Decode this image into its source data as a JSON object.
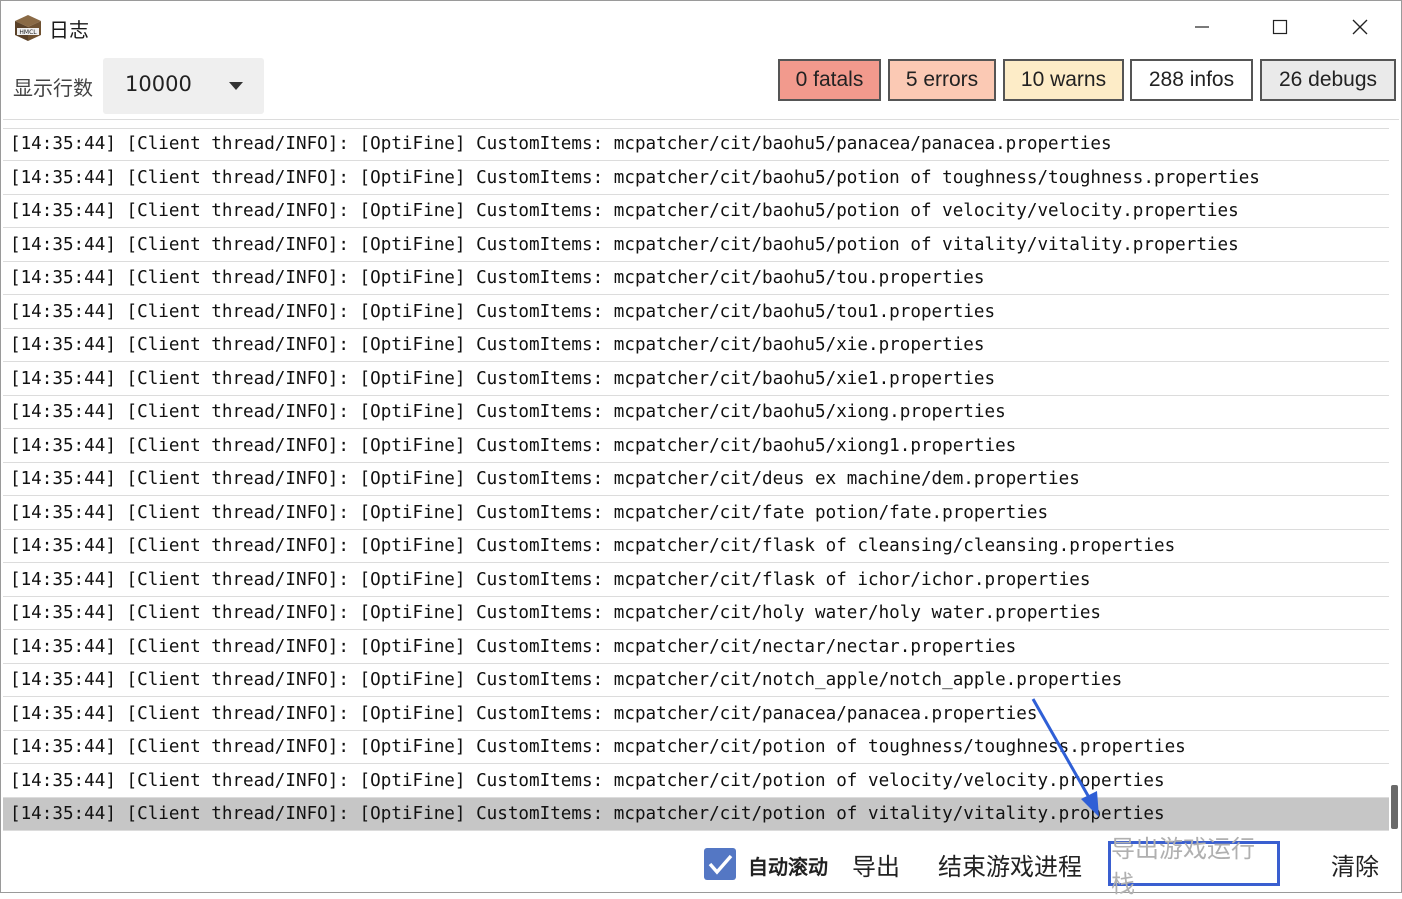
{
  "window": {
    "title": "日志",
    "icon": "hmcl-icon",
    "controls": [
      "minimize-icon",
      "maximize-icon",
      "close-icon"
    ]
  },
  "toolbar": {
    "rows_label": "显示行数",
    "rows_value": "10000",
    "filters": {
      "fatals": "0 fatals",
      "errors": "5 errors",
      "warns": "10 warns",
      "infos": "288 infos",
      "debugs": "26 debugs"
    }
  },
  "log": {
    "lines": [
      "[14:35:44] [Client thread/INFO]: [OptiFine] CustomItems: mcpatcher/cit/baohu5/panacea/panacea.properties",
      "[14:35:44] [Client thread/INFO]: [OptiFine] CustomItems: mcpatcher/cit/baohu5/potion of toughness/toughness.properties",
      "[14:35:44] [Client thread/INFO]: [OptiFine] CustomItems: mcpatcher/cit/baohu5/potion of velocity/velocity.properties",
      "[14:35:44] [Client thread/INFO]: [OptiFine] CustomItems: mcpatcher/cit/baohu5/potion of vitality/vitality.properties",
      "[14:35:44] [Client thread/INFO]: [OptiFine] CustomItems: mcpatcher/cit/baohu5/tou.properties",
      "[14:35:44] [Client thread/INFO]: [OptiFine] CustomItems: mcpatcher/cit/baohu5/tou1.properties",
      "[14:35:44] [Client thread/INFO]: [OptiFine] CustomItems: mcpatcher/cit/baohu5/xie.properties",
      "[14:35:44] [Client thread/INFO]: [OptiFine] CustomItems: mcpatcher/cit/baohu5/xie1.properties",
      "[14:35:44] [Client thread/INFO]: [OptiFine] CustomItems: mcpatcher/cit/baohu5/xiong.properties",
      "[14:35:44] [Client thread/INFO]: [OptiFine] CustomItems: mcpatcher/cit/baohu5/xiong1.properties",
      "[14:35:44] [Client thread/INFO]: [OptiFine] CustomItems: mcpatcher/cit/deus ex machine/dem.properties",
      "[14:35:44] [Client thread/INFO]: [OptiFine] CustomItems: mcpatcher/cit/fate potion/fate.properties",
      "[14:35:44] [Client thread/INFO]: [OptiFine] CustomItems: mcpatcher/cit/flask of cleansing/cleansing.properties",
      "[14:35:44] [Client thread/INFO]: [OptiFine] CustomItems: mcpatcher/cit/flask of ichor/ichor.properties",
      "[14:35:44] [Client thread/INFO]: [OptiFine] CustomItems: mcpatcher/cit/holy water/holy water.properties",
      "[14:35:44] [Client thread/INFO]: [OptiFine] CustomItems: mcpatcher/cit/nectar/nectar.properties",
      "[14:35:44] [Client thread/INFO]: [OptiFine] CustomItems: mcpatcher/cit/notch_apple/notch_apple.properties",
      "[14:35:44] [Client thread/INFO]: [OptiFine] CustomItems: mcpatcher/cit/panacea/panacea.properties",
      "[14:35:44] [Client thread/INFO]: [OptiFine] CustomItems: mcpatcher/cit/potion of toughness/toughness.properties",
      "[14:35:44] [Client thread/INFO]: [OptiFine] CustomItems: mcpatcher/cit/potion of velocity/velocity.properties",
      "[14:35:44] [Client thread/INFO]: [OptiFine] CustomItems: mcpatcher/cit/potion of vitality/vitality.properties"
    ],
    "selected_index": 20
  },
  "bottom": {
    "auto_scroll_label": "自动滚动",
    "auto_scroll_checked": true,
    "export_label": "导出",
    "kill_label": "结束游戏进程",
    "export_stack_label": "导出游戏运行栈",
    "clear_label": "清除"
  },
  "colors": {
    "fatals": "#f29a8d",
    "errors": "#fbc9b4",
    "warns": "#fdecc7",
    "infos": "#ffffff",
    "debugs": "#eaeaea",
    "accent": "#3a5fd0",
    "checkbox": "#5477c4"
  }
}
